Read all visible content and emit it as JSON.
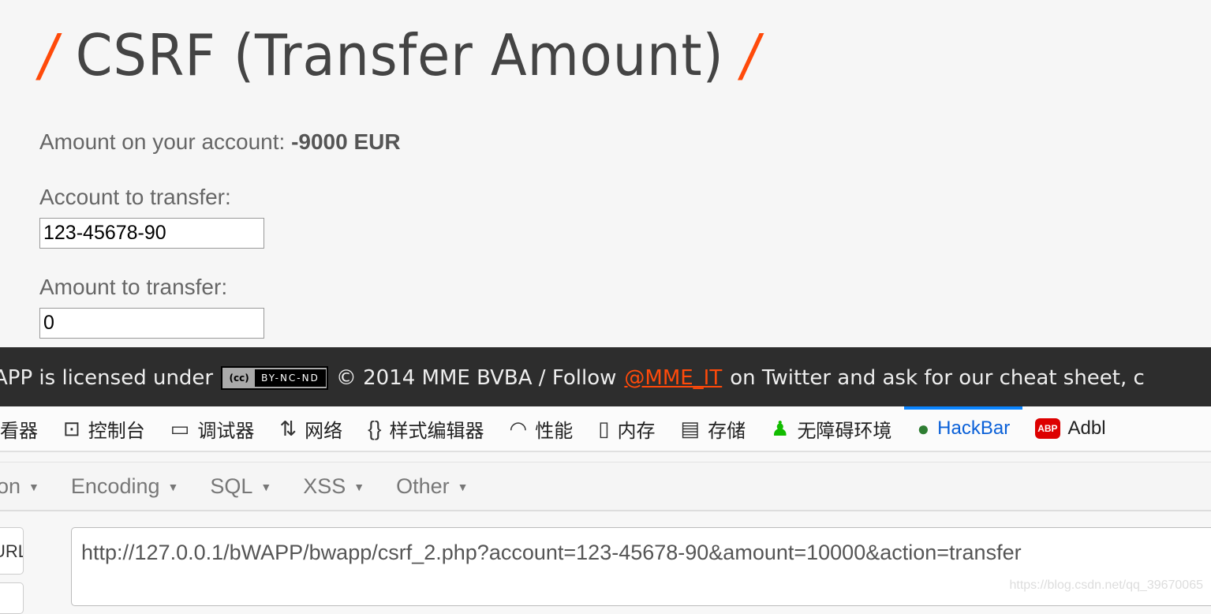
{
  "page": {
    "title": "CSRF (Transfer Amount)",
    "amount_label": "Amount on your account:",
    "amount_value": "-9000 EUR",
    "account_label": "Account to transfer:",
    "account_value": "123-45678-90",
    "transfer_label": "Amount to transfer:",
    "transfer_value": "0"
  },
  "footer": {
    "text1": "APP is licensed under",
    "cc_badge": "BY-NC-ND",
    "cc_logo": "cc",
    "text2": "© 2014 MME BVBA / Follow",
    "link": "@MME_IT",
    "text3": "on Twitter and ask for our cheat sheet, c"
  },
  "devtools": {
    "tabs": [
      {
        "label": "看器",
        "icon": "inspector-icon"
      },
      {
        "label": "控制台",
        "icon": "console-icon"
      },
      {
        "label": "调试器",
        "icon": "debugger-icon"
      },
      {
        "label": "网络",
        "icon": "network-icon"
      },
      {
        "label": "样式编辑器",
        "icon": "style-editor-icon"
      },
      {
        "label": "性能",
        "icon": "performance-icon"
      },
      {
        "label": "内存",
        "icon": "memory-icon"
      },
      {
        "label": "存储",
        "icon": "storage-icon"
      },
      {
        "label": "无障碍环境",
        "icon": "accessibility-icon"
      },
      {
        "label": "HackBar",
        "icon": "hackbar-icon",
        "active": true
      },
      {
        "label": "Adbl",
        "icon": "adblock-icon"
      }
    ]
  },
  "hackbar": {
    "menus": [
      "on",
      "Encoding",
      "SQL",
      "XSS",
      "Other"
    ],
    "url_button": "URL",
    "url_value": "http://127.0.0.1/bWAPP/bwapp/csrf_2.php?account=123-45678-90&amount=10000&action=transfer"
  },
  "watermark": "https://blog.csdn.net/qq_39670065",
  "colors": {
    "accent": "#ff4a0a",
    "active_tab": "#0a84ff"
  }
}
